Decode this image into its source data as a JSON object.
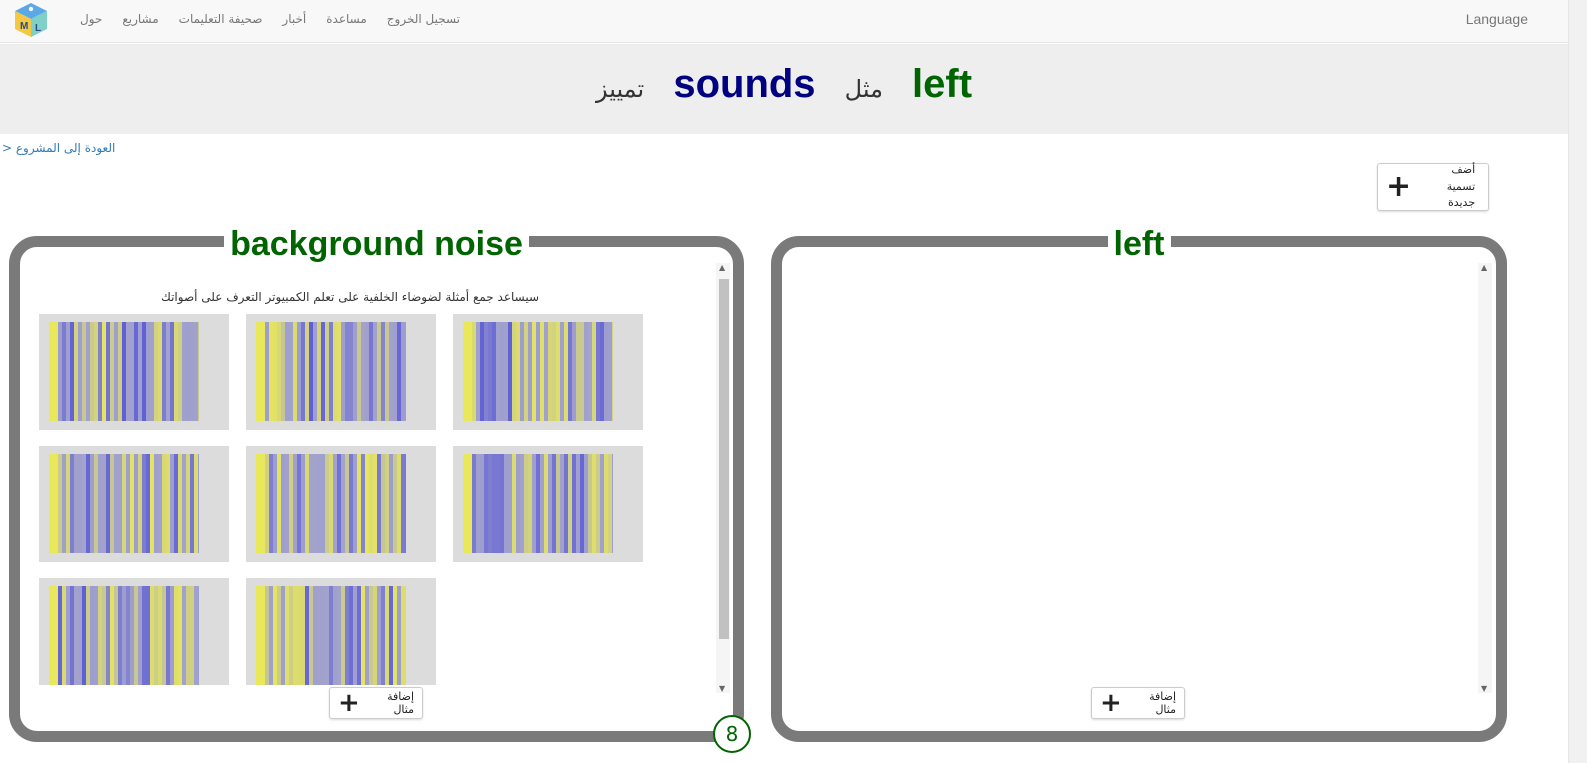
{
  "nav": {
    "links": [
      "حول",
      "مشاريع",
      "صحيفة التعليمات",
      "أخبار",
      "مساعدة",
      "تسجيل الخروج"
    ],
    "language": "Language",
    "logo_letters": [
      "M",
      "L"
    ]
  },
  "header": {
    "words": [
      "left",
      "مثل",
      "sounds",
      "تمييز"
    ]
  },
  "back_link": "العودة إلى المشروع <",
  "add_label_button": "أضف تسمية جديدة",
  "labels": [
    {
      "title": "background noise",
      "description": "سيساعد جمع أمثلة لضوضاء الخلفية على تعلم الكمبيوتر التعرف على أصواتك",
      "add_example": "إضافة مثال",
      "count": "8",
      "examples": [
        "spectrogram-1",
        "spectrogram-2",
        "spectrogram-3",
        "spectrogram-4",
        "spectrogram-5",
        "spectrogram-6",
        "spectrogram-7",
        "spectrogram-8"
      ]
    },
    {
      "title": "left",
      "add_example": "إضافة مثال",
      "examples": []
    }
  ],
  "colors": {
    "label_title": "#006400",
    "sounds": "#000080",
    "spectro_yellow": "#e8e85a",
    "spectro_blue": "#5a5ad8",
    "box_border": "#7a7a7a"
  }
}
